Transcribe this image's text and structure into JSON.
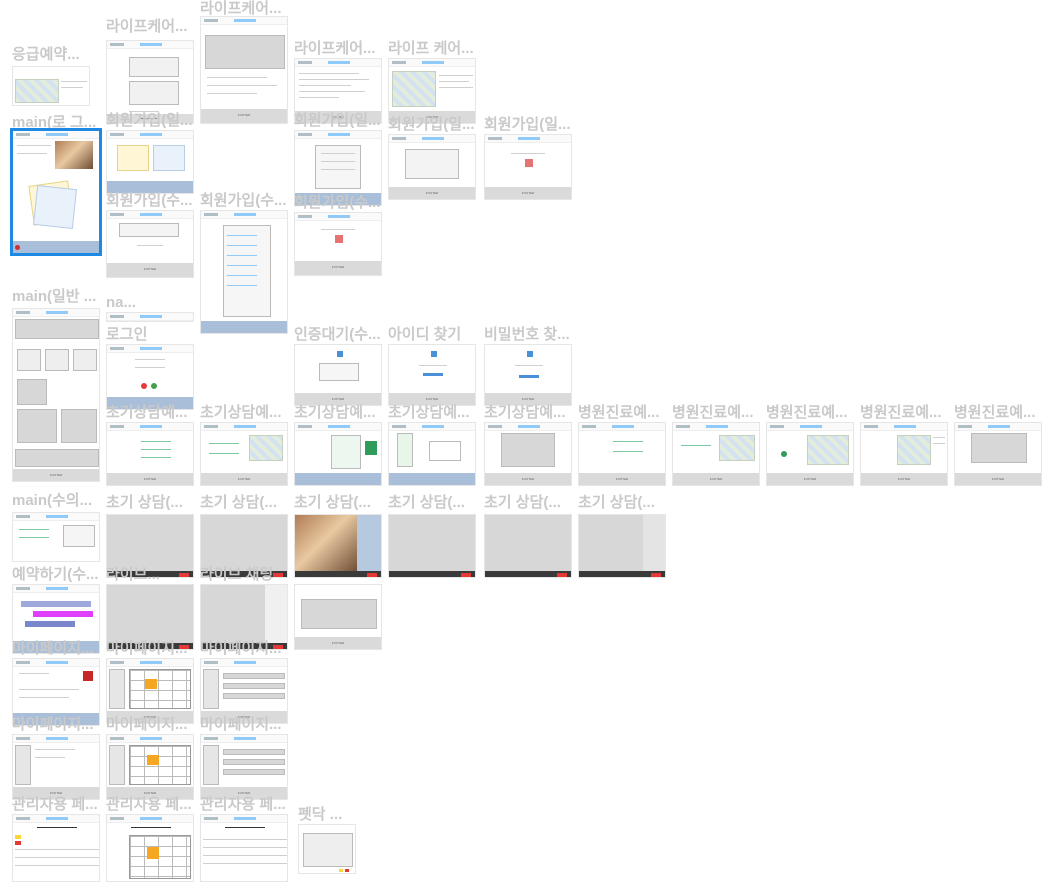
{
  "canvas": {
    "background": "#ffffff",
    "label_color": "#c9c9c9",
    "selection_color": "#1e88e5"
  },
  "frames": [
    {
      "id": "f01",
      "label": "응급예약..."
    },
    {
      "id": "f02",
      "label": "라이프케어..."
    },
    {
      "id": "f03",
      "label": "라이프케어..."
    },
    {
      "id": "f04",
      "label": "라이프케어..."
    },
    {
      "id": "f05",
      "label": "라이프 케어..."
    },
    {
      "id": "f06",
      "label": "main(로 그..."
    },
    {
      "id": "f07",
      "label": "회원가입(일..."
    },
    {
      "id": "f08",
      "label": "회원가입(일..."
    },
    {
      "id": "f09",
      "label": "회원가입(일..."
    },
    {
      "id": "f10",
      "label": "회원가입(일..."
    },
    {
      "id": "f11",
      "label": "회원가입(수..."
    },
    {
      "id": "f12",
      "label": "회원가입(수..."
    },
    {
      "id": "f13",
      "label": "회원가입(수..."
    },
    {
      "id": "f14",
      "label": "main(일반 ..."
    },
    {
      "id": "f15",
      "label": "na..."
    },
    {
      "id": "f16",
      "label": "로그인"
    },
    {
      "id": "f17",
      "label": "인증대기(수..."
    },
    {
      "id": "f18",
      "label": "아이디 찾기"
    },
    {
      "id": "f19",
      "label": "비밀번호 찾..."
    },
    {
      "id": "f20",
      "label": "초기상담예..."
    },
    {
      "id": "f21",
      "label": "초기상담예..."
    },
    {
      "id": "f22",
      "label": "초기상담예..."
    },
    {
      "id": "f23",
      "label": "초기상담예..."
    },
    {
      "id": "f24",
      "label": "초기상담예..."
    },
    {
      "id": "f25",
      "label": "병원진료예..."
    },
    {
      "id": "f26",
      "label": "병원진료예..."
    },
    {
      "id": "f27",
      "label": "병원진료예..."
    },
    {
      "id": "f28",
      "label": "병원진료예..."
    },
    {
      "id": "f29",
      "label": "병원진료예..."
    },
    {
      "id": "f30",
      "label": "main(수의..."
    },
    {
      "id": "f31",
      "label": "초기 상담(..."
    },
    {
      "id": "f32",
      "label": "초기 상담(..."
    },
    {
      "id": "f33",
      "label": "초기 상담(..."
    },
    {
      "id": "f34",
      "label": "초기 상담(..."
    },
    {
      "id": "f35",
      "label": "초기 상담(..."
    },
    {
      "id": "f36",
      "label": "초기 상담(..."
    },
    {
      "id": "f37",
      "label": "예약하기(수..."
    },
    {
      "id": "f38",
      "label": "라이브..."
    },
    {
      "id": "f39",
      "label": "라이브 채팅"
    },
    {
      "id": "f40",
      "label": "마이페이지..."
    },
    {
      "id": "f41",
      "label": "마이페이지..."
    },
    {
      "id": "f42",
      "label": "마이페이지..."
    },
    {
      "id": "f43",
      "label": "마이페이지..."
    },
    {
      "id": "f44",
      "label": "마이페이지..."
    },
    {
      "id": "f45",
      "label": "마이페이지..."
    },
    {
      "id": "f46",
      "label": "관리자용 페..."
    },
    {
      "id": "f47",
      "label": "관리자용 페..."
    },
    {
      "id": "f48",
      "label": "관리자용 페..."
    },
    {
      "id": "f49",
      "label": "펫닥 ..."
    }
  ]
}
